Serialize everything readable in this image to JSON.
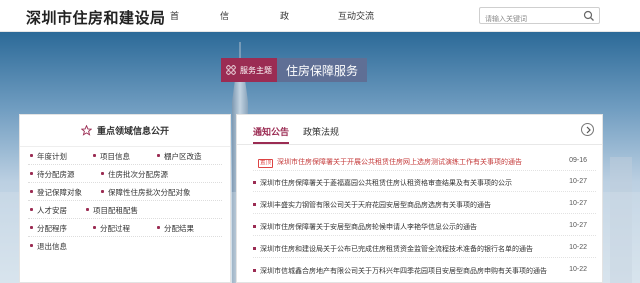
{
  "header": {
    "logo": "深圳市住房和建设局",
    "nav": [
      "首页",
      "信息公开",
      "政务服务",
      "互动交流"
    ],
    "search": {
      "placeholder": "请输入关键词"
    }
  },
  "theme": {
    "tag": "服务主题",
    "title": "住房保障服务"
  },
  "focus": {
    "title": "重点领域信息公开",
    "rows": [
      [
        "年度计划",
        "项目信息",
        "棚户区改造"
      ],
      [
        "待分配房源",
        "住房批次分配房源"
      ],
      [
        "登记保障对象",
        "保障性住房批次分配对象"
      ],
      [
        "人才安居",
        "项目配租配售"
      ],
      [
        "分配程序",
        "分配过程",
        "分配结果"
      ],
      [
        "退出信息"
      ]
    ]
  },
  "tabs": {
    "active": "通知公告",
    "other": "政策法规"
  },
  "news": [
    {
      "badge": "置顶",
      "title": "深圳市住房保障署关于开展公共租赁住房网上选房测试演练工作有关事项的通告",
      "date": "09-16"
    },
    {
      "title": "深圳市住房保障署关于菱福嘉园公共租赁住房认租资格审查结果及有关事项的公示",
      "date": "10-27"
    },
    {
      "title": "深圳丰盛实力钢管有限公司关于天府花园安居型商品房选房有关事项的通告",
      "date": "10-27"
    },
    {
      "title": "深圳市住房保障署关于安居型商品房轮候申请人李艳华信息公示的通告",
      "date": "10-27"
    },
    {
      "title": "深圳市住房和建设局关于公布已完成住房租赁资金监管全流程技术准备的银行名单的通告",
      "date": "10-22"
    },
    {
      "title": "深圳市信城鑫合房地产有限公司关于万科兴年四季花园项目安居型商品房申购有关事项的通告",
      "date": "10-22"
    }
  ]
}
